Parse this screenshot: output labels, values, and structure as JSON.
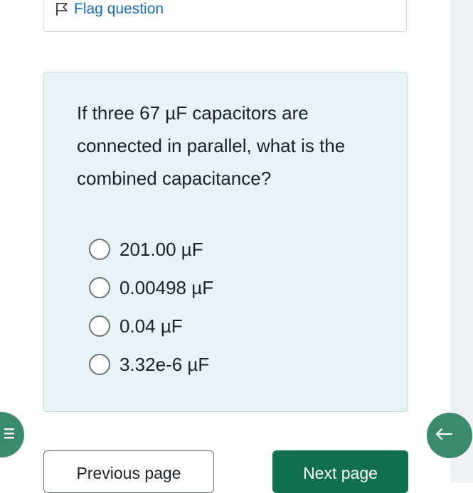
{
  "flag": {
    "label": "Flag question",
    "icon": "flag-outline-icon"
  },
  "question": {
    "text": "If three 67 µF capacitors are connected in parallel, what is the combined capacitance?",
    "options": [
      {
        "label": "201.00 µF",
        "selected": false
      },
      {
        "label": "0.00498 µF",
        "selected": false
      },
      {
        "label": "0.04 µF",
        "selected": false
      },
      {
        "label": "3.32e-6 µF",
        "selected": false
      }
    ]
  },
  "navigation": {
    "previous_label": "Previous page",
    "next_label": "Next page",
    "drawer_icon": "menu-icon",
    "back_icon": "arrow-left-icon"
  },
  "colors": {
    "accent": "#0f6f4f",
    "fab": "#3a8a6d",
    "link": "#0f6cbf",
    "question_bg": "#e7f3f5",
    "question_border": "#b8dce2"
  }
}
